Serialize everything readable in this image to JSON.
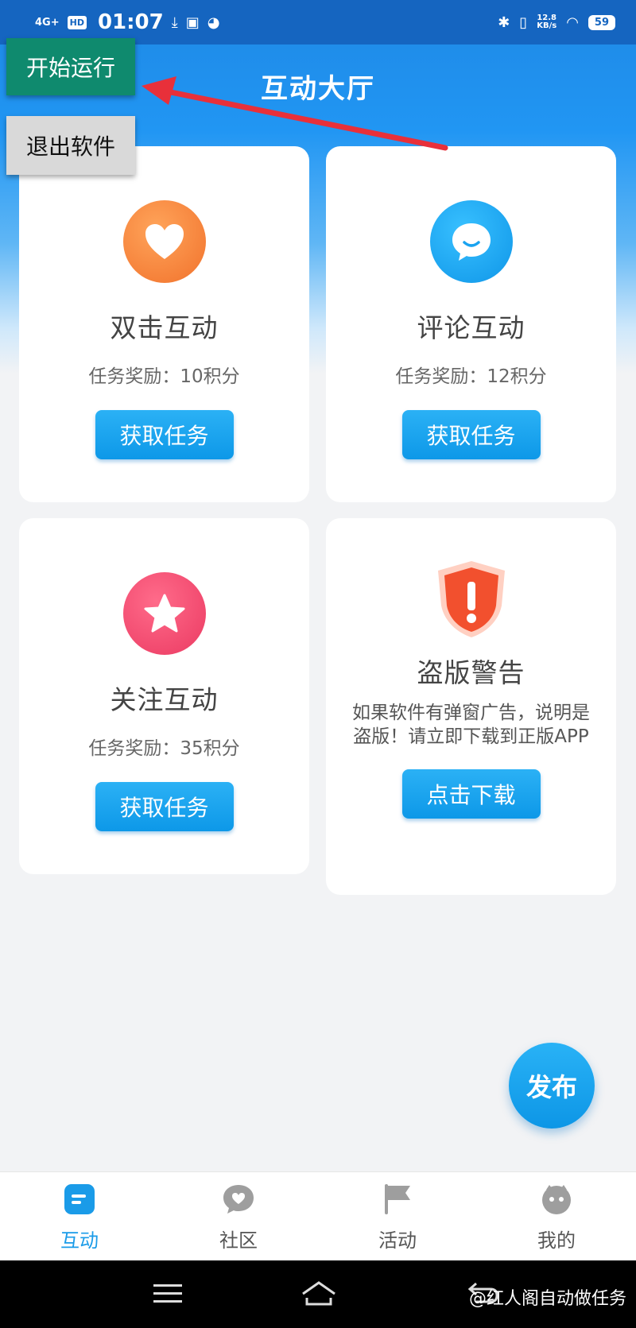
{
  "status_bar": {
    "network": "4G+",
    "hd": "HD",
    "time": "01:07",
    "speed_value": "12.8",
    "speed_unit": "KB/s",
    "battery": "59"
  },
  "overlay": {
    "start_label": "开始运行",
    "exit_label": "退出软件",
    "arrow_color": "#e8303a"
  },
  "header": {
    "title": "互动大厅"
  },
  "cards": [
    {
      "title": "双击互动",
      "reward": "任务奖励：10积分",
      "button": "获取任务",
      "icon": "heart-icon",
      "color": "#f47e3c"
    },
    {
      "title": "评论互动",
      "reward": "任务奖励：12积分",
      "button": "获取任务",
      "icon": "chat-bubble-icon",
      "color": "#1aa3f0"
    },
    {
      "title": "关注互动",
      "reward": "任务奖励：35积分",
      "button": "获取任务",
      "icon": "star-icon",
      "color": "#f0426a"
    },
    {
      "title": "盗版警告",
      "description": "如果软件有弹窗广告，说明是盗版！请立即下载到正版APP",
      "button": "点击下载",
      "icon": "warning-shield-icon",
      "color": "#f2502e"
    }
  ],
  "fab": {
    "label": "发布"
  },
  "tabs": [
    {
      "label": "互动",
      "icon": "document-icon",
      "active": true
    },
    {
      "label": "社区",
      "icon": "heart-bubble-icon",
      "active": false
    },
    {
      "label": "活动",
      "icon": "flag-icon",
      "active": false
    },
    {
      "label": "我的",
      "icon": "face-icon",
      "active": false
    }
  ],
  "nav": {
    "watermark": "@红人阁自动做任务"
  },
  "colors": {
    "primary": "#1a9be8",
    "brand_blue": "#1e88e5",
    "start_green": "#0f8a6e"
  }
}
